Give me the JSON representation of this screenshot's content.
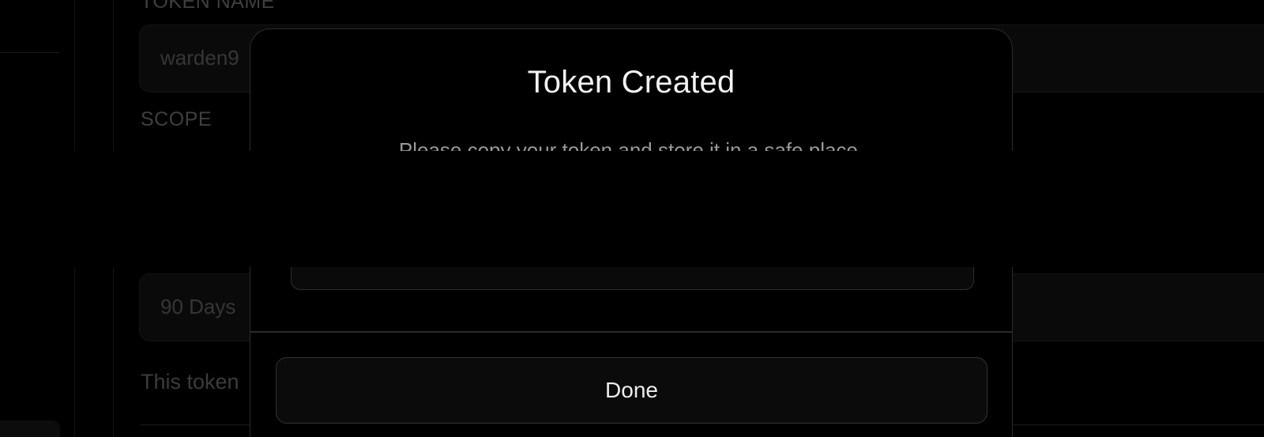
{
  "background": {
    "token_name_label": "TOKEN NAME",
    "token_name_value": "warden9",
    "scope_label": "SCOPE",
    "expiry_value": "90 Days",
    "help_text": "This token"
  },
  "modal": {
    "title": "Token Created",
    "description": "Please copy your token and store it in a safe place.",
    "token_value": "",
    "copy_icon": "copy-icon",
    "done_label": "Done"
  },
  "colors": {
    "background": "#000000",
    "modal_border": "#2b2b2b",
    "text_primary": "#f2f2f2",
    "text_secondary": "#9a9a9a"
  }
}
